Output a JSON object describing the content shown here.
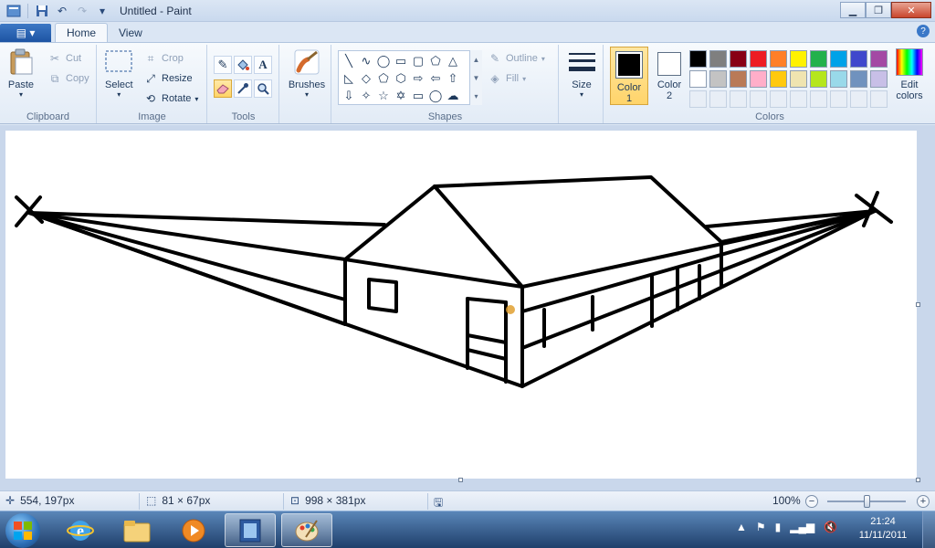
{
  "window": {
    "title": "Untitled - Paint",
    "controls": {
      "minimize": "▁",
      "maximize": "❐",
      "close": "✕"
    }
  },
  "quick_access": {
    "save": "💾",
    "undo": "↶",
    "redo": "↷",
    "customize": "▾"
  },
  "tabs": {
    "appmenu_icon": "▤ ▾",
    "items": [
      "Home",
      "View"
    ],
    "active": "Home",
    "help": "?"
  },
  "ribbon": {
    "clipboard": {
      "label": "Clipboard",
      "paste": "Paste",
      "cut": "Cut",
      "copy": "Copy"
    },
    "image": {
      "label": "Image",
      "select": "Select",
      "crop": "Crop",
      "resize": "Resize",
      "rotate": "Rotate"
    },
    "tools": {
      "label": "Tools",
      "items": [
        "pencil-icon",
        "fill-icon",
        "text-icon",
        "eraser-icon",
        "color-picker-icon",
        "magnifier-icon"
      ],
      "active": "eraser-icon"
    },
    "brushes": {
      "label": "Brushes"
    },
    "shapes": {
      "label": "Shapes",
      "outline": "Outline",
      "fill": "Fill"
    },
    "size": {
      "label": "Size"
    },
    "colors": {
      "label": "Colors",
      "color1": "Color",
      "color1_num": "1",
      "color2": "Color",
      "color2_num": "2",
      "edit": "Edit",
      "edit2": "colors",
      "color1_value": "#000000",
      "color2_value": "#ffffff",
      "palette_row1": [
        "#000000",
        "#7f7f7f",
        "#880015",
        "#ed1c24",
        "#ff7f27",
        "#fff200",
        "#22b14c",
        "#00a2e8",
        "#3f48cc",
        "#a349a4"
      ],
      "palette_row2": [
        "#ffffff",
        "#c3c3c3",
        "#b97a57",
        "#ffaec9",
        "#ffc90e",
        "#efe4b0",
        "#b5e61d",
        "#99d9ea",
        "#7092be",
        "#c8bfe7"
      ]
    }
  },
  "status": {
    "cursor": "554, 197px",
    "selection": "81 × 67px",
    "canvas_size": "998 × 381px",
    "zoom": "100%",
    "zoom_out": "−",
    "zoom_in": "+"
  },
  "taskbar": {
    "time": "21:24",
    "date": "11/11/2011",
    "apps": [
      "ie-icon",
      "explorer-icon",
      "media-player-icon",
      "movie-maker-icon",
      "paint-icon"
    ],
    "active_app": "paint-icon"
  }
}
